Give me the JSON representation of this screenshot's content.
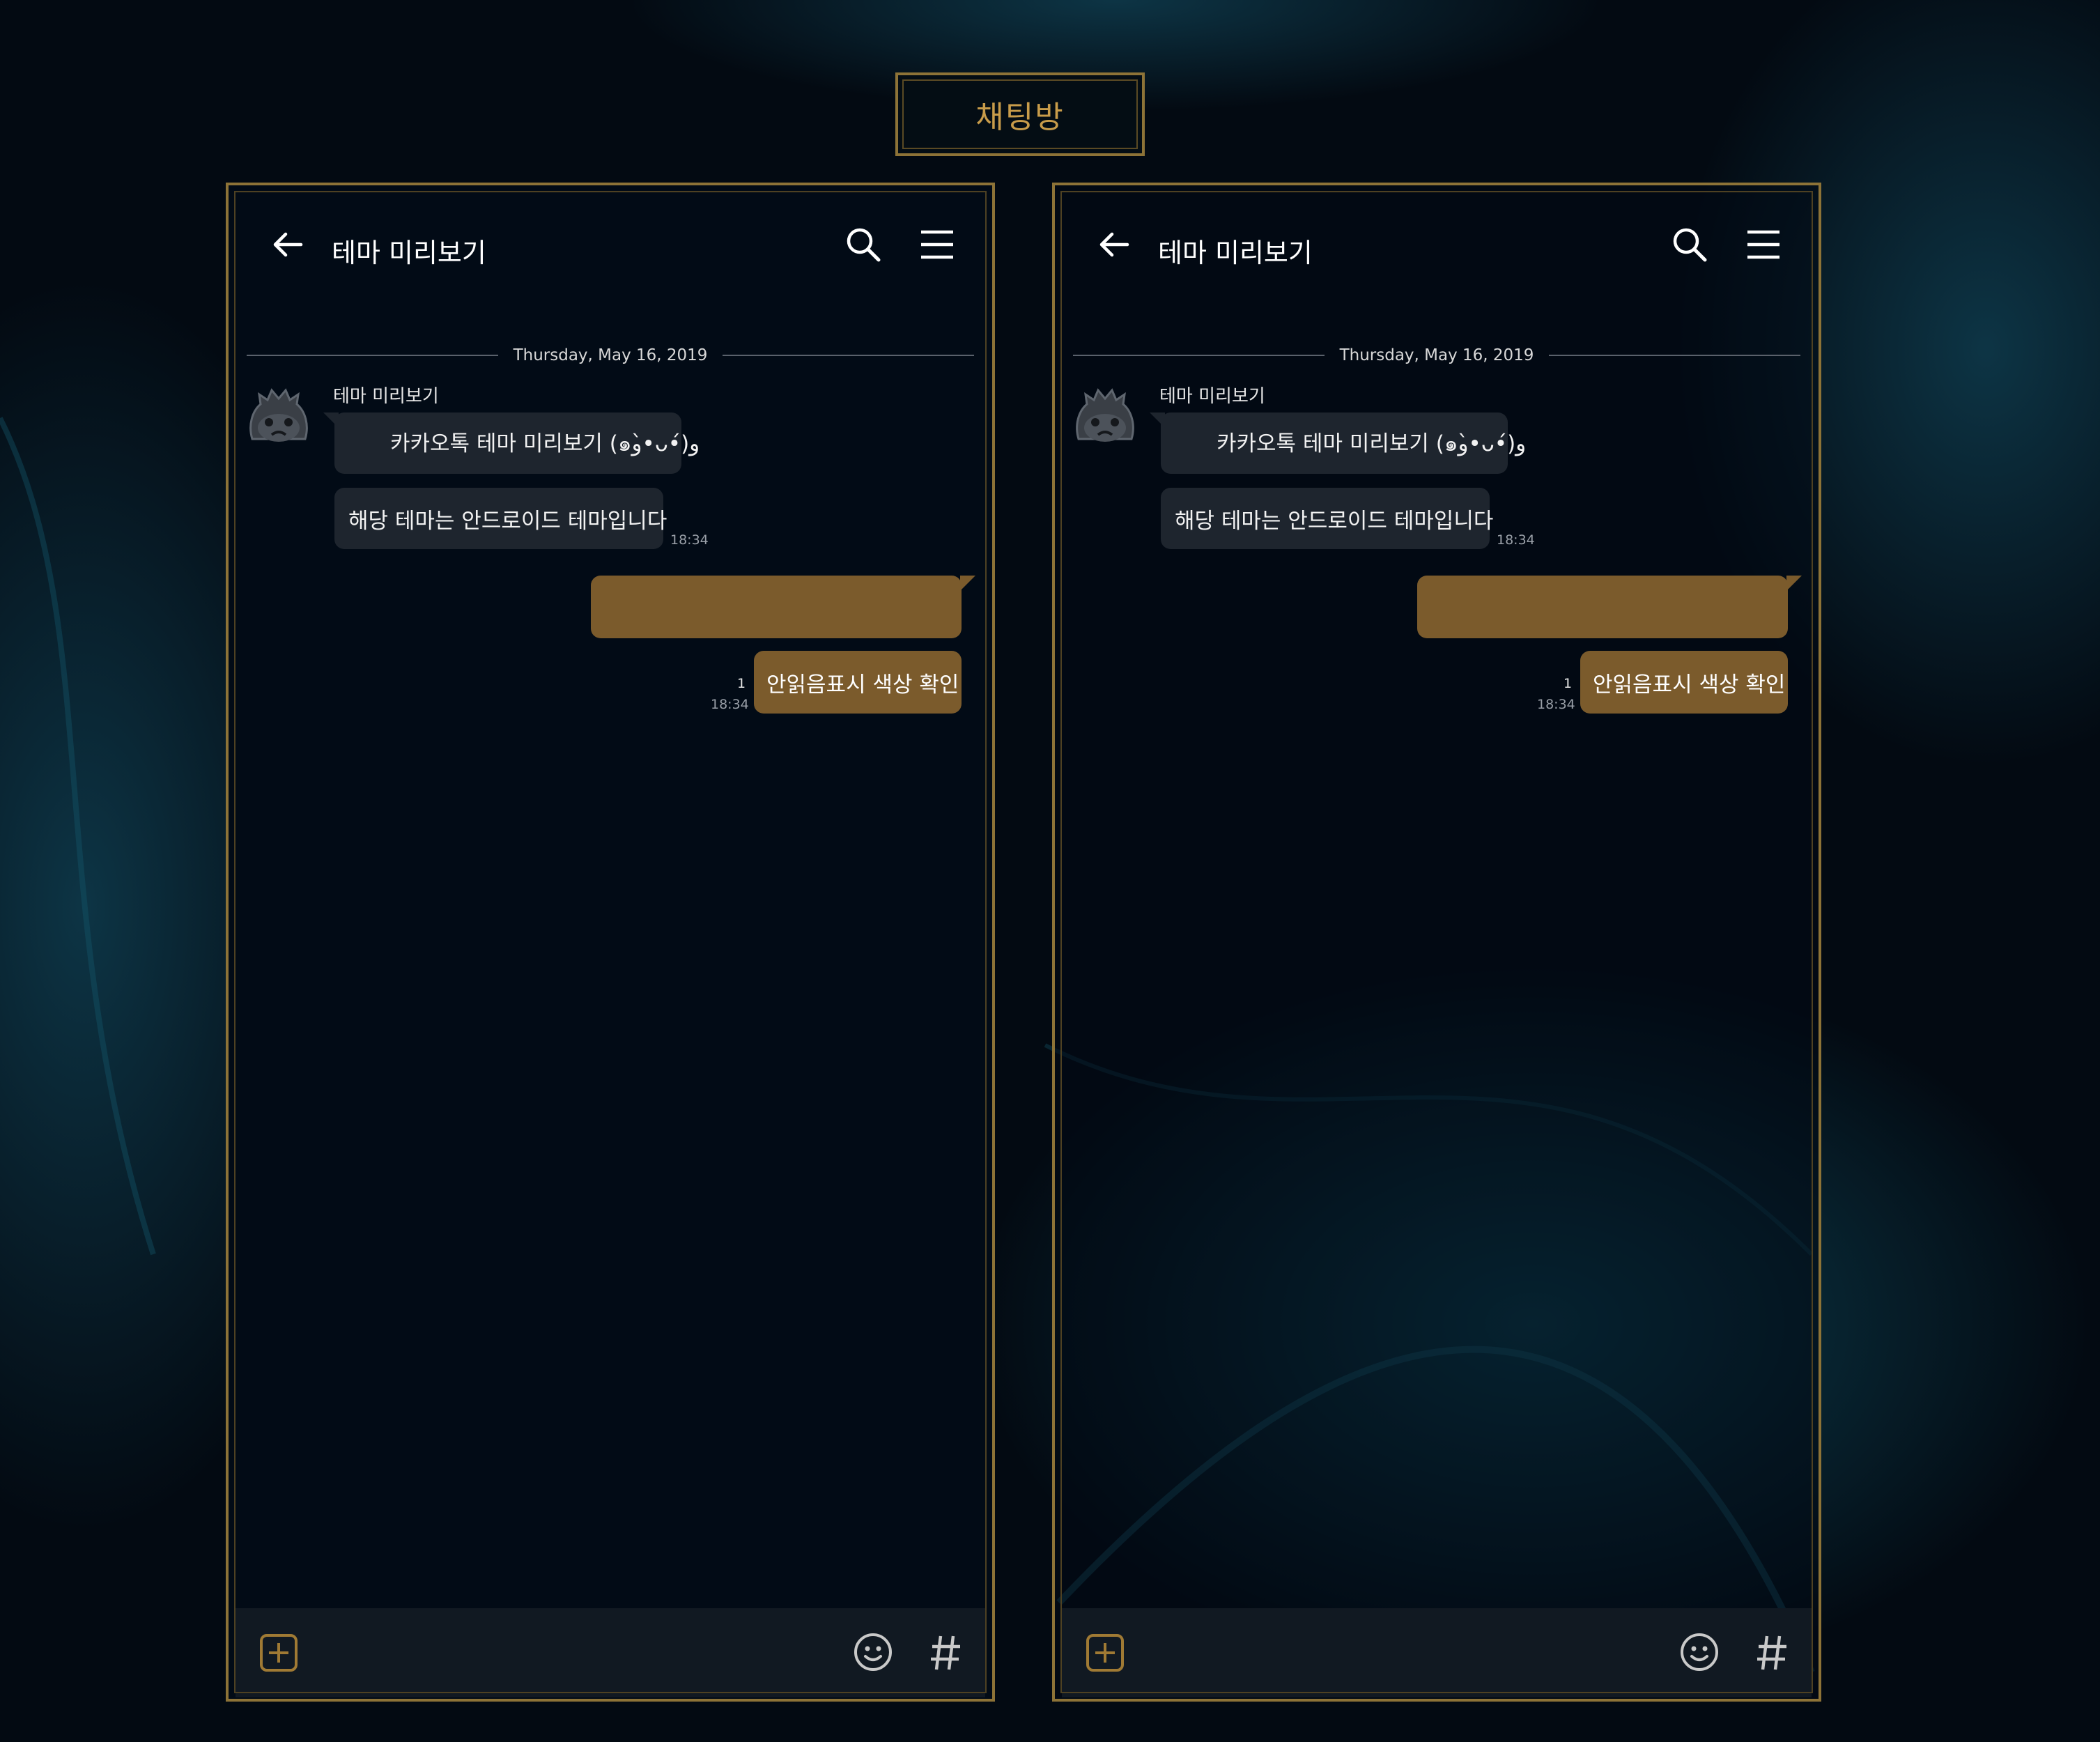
{
  "page": {
    "title": "채팅방"
  },
  "phones": [
    {
      "room_title": "테마 미리보기",
      "date": "Thursday, May 16, 2019",
      "sender": "테마 미리보기",
      "messages": [
        {
          "text": "카카오톡 테마 미리보기 (๑و•̀ᴗ•́)و"
        },
        {
          "text": "해당 테마는 안드로이드 테마입니다",
          "time": "18:34"
        },
        {
          "text": ""
        },
        {
          "text": "안읽음표시 색상 확인",
          "unread": "1",
          "time": "18:34"
        }
      ]
    },
    {
      "room_title": "테마 미리보기",
      "date": "Thursday, May 16, 2019",
      "sender": "테마 미리보기",
      "messages": [
        {
          "text": "카카오톡 테마 미리보기 (๑و•̀ᴗ•́)و"
        },
        {
          "text": "해당 테마는 안드로이드 테마입니다",
          "time": "18:34"
        },
        {
          "text": ""
        },
        {
          "text": "안읽음표시 색상 확인",
          "unread": "1",
          "time": "18:34"
        }
      ]
    }
  ],
  "icons": {
    "back": "arrow-left-icon",
    "search": "search-icon",
    "menu": "hamburger-menu-icon",
    "attach": "plus-square-icon",
    "emoji": "emoji-icon",
    "hashtag": "hashtag-icon",
    "avatar": "poro-avatar"
  },
  "colors": {
    "gold_border": "#8d7337",
    "title_text": "#c89c4a",
    "outgoing_bubble": "#7b5b2c",
    "incoming_bubble": "#1e252e",
    "background": "#030a12"
  }
}
